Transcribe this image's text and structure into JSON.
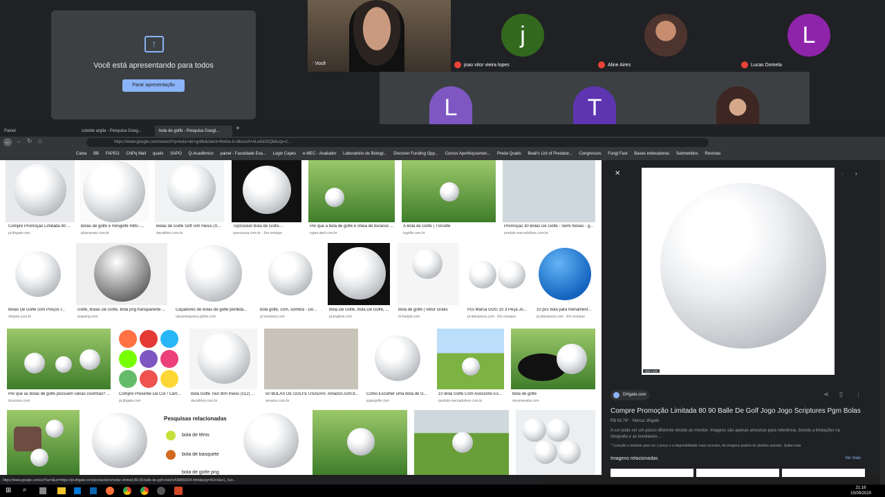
{
  "meet": {
    "presenting_text": "Você está apresentando para todos",
    "stop_button": "Parar apresentação",
    "self_label": "Você",
    "participants": [
      {
        "initial": "j",
        "name": "joao vitor vieira lopes",
        "color": "#33691e"
      },
      {
        "initial": "",
        "name": "Aline Aires",
        "color": "#8d6e63"
      },
      {
        "initial": "L",
        "name": "Lucas Domela",
        "color": "#8e24aa"
      }
    ],
    "row2": [
      {
        "initial": "L",
        "color": "#7e57c2"
      },
      {
        "initial": "T",
        "color": "#5e35b1"
      }
    ]
  },
  "tabs": [
    "Painel",
    "coloide argila - Pesquisa Goog...",
    "bola de golfe - Pesquisa Googl..."
  ],
  "omnibox": "https://www.google.com/search?q=bola+de+golfe&client=firefox-b-d&sxsrf=ALeKk02Qb&sqi=2...",
  "bookmarks": [
    "Caixa",
    "BB",
    "FAPEG",
    "CNPq Mail",
    "qualis",
    "SAPO",
    "Q-Acadêmico",
    "painel - Faculdade Eva...",
    "Login Capes",
    "e-MEC - Avaliador",
    "Laboratório de Biologi...",
    "Discover Funding Opp...",
    "Cursos Aperfeiçoamen...",
    "Preda Qualis",
    "Beall's List of Predator...",
    "Congressos",
    "Fungi Fast",
    "Bases indexadoras",
    "Submetidos",
    "Revistas"
  ],
  "row1": [
    {
      "cap": "Compre Promoção Limitada 80 ...",
      "src": "pt.dhgate.com"
    },
    {
      "cap": "Bolas de golfe e minigolfe Hitto -...",
      "src": "pluscampo.com.br"
    },
    {
      "cap": "Bolas de Golfe Soft 500 Inesis (X...",
      "src": "decathlon.com.br"
    },
    {
      "cap": "TopSocket Bola de Golfe-...",
      "src": "querocasa.com.br · Em estoque"
    },
    {
      "cap": "Por que a bola de golfe é cheia de buracos ...",
      "src": "super.abril.com.br"
    },
    {
      "cap": "A Bola de Golfe | TSGolfe",
      "src": "tsgolfe.com.br"
    },
    {
      "cap": "Promoção 30 Bolas De Golfe - Semi Novas - g...",
      "src": "produto.mercadolivre.com.br"
    }
  ],
  "row2": [
    {
      "cap": "Bolas De Golfe com Preços I...",
      "src": "shopee.com.br"
    },
    {
      "cap": "Golfe, Bolas De Golfe, Bola png transparente ...",
      "src": "pngwing.com"
    },
    {
      "cap": "Caçadores de bolas de golfe perdida...",
      "src": "opcaonegocios.globo.com"
    },
    {
      "cap": "bola golfe, com, sombra - Do...",
      "src": "pt.vecteezy.com"
    },
    {
      "cap": "Bola De Golfe, Bola De Golfe, ...",
      "src": "pt.pngtree.com"
    },
    {
      "cap": "Bola de golfe | Vetor Grátis",
      "src": "br.freepik.com"
    },
    {
      "cap": "Pcs Marca GOG 10 3 Peça Jo...",
      "src": "pt.aliexpress.com · Em estoque"
    },
    {
      "cap": "10 pcs bola para treinament...",
      "src": "pt.aliexpress.com · Em estoque"
    }
  ],
  "row3": [
    {
      "cap": "Por que as bolas de golfe possuem várias covinhas? ...",
      "src": "tricurioso.com"
    },
    {
      "cap": "Compre Presente Da Cor / Cart...",
      "src": "pt.dhgate.com"
    },
    {
      "cap": "Bola Golfe Tour 800 Inesis (x12) ...",
      "src": "decathlon.com.br"
    },
    {
      "cap": "50 BOLAS DE GOLFE USADAS: Amazon.com.b...",
      "src": "amazon.com.br"
    },
    {
      "cap": "Como Escolher uma Bola de G...",
      "src": "jogargolfe.com"
    },
    {
      "cap": "10 Bola Golfe Com Acessório Ex...",
      "src": "produto.mercadolivre.com.br"
    },
    {
      "cap": "Bola de golfe",
      "src": "meumeeabe.com"
    }
  ],
  "related": {
    "title": "Pesquisas relacionadas",
    "items": [
      "bola de tênis",
      "bola de basquete",
      "bola de golfe png"
    ]
  },
  "panel": {
    "source": "DHgate.com",
    "title": "Compre Promoção Limitada 80 90 Balle De Golf Jogo Jogo Scriptures Pgm Bolas",
    "price": "R$ 93,78*",
    "brand": "Marca: dhgate",
    "desc": "A cor pode ser um pouco diferente devido ao monitor. Imagens são apenas amostras para referência. Devido a limitações na fotografia e as inevitáveis ...",
    "note": "* Consulte o website para ver o preço e a disponibilidade mais recentes. As imagens podem ter direitos autorais. Saiba mais",
    "related_title": "Imagens relacionadas",
    "see_more": "Ver mais",
    "size": "268 × 400"
  },
  "status_url": "https://www.google.com/url?sa=i&url=https://pt.dhgate.com/product/promotion-limited-80-90-balle-de-golf-match/438856604.html&psig=AOvVaw1_Xye...",
  "clock": {
    "time": "21:16",
    "date": "15/09/2020"
  }
}
